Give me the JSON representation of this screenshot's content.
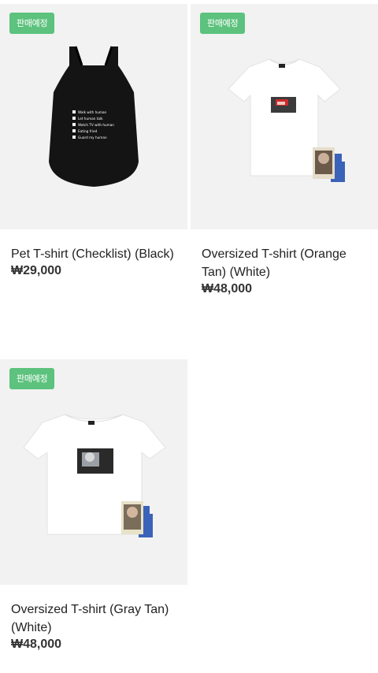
{
  "products": [
    {
      "badge": "판매예정",
      "title": "Pet T-shirt (Checklist) (Black)",
      "price": "₩29,000",
      "checklist": [
        "Walk with human",
        "Let human talk",
        "Watch TV with human",
        "Eating fried",
        "Guard my human"
      ]
    },
    {
      "badge": "판매예정",
      "title": "Oversized T-shirt (Orange Tan) (White)",
      "price": "₩48,000"
    },
    {
      "badge": "판매예정",
      "title": "Oversized T-shirt (Gray Tan) (White)",
      "price": "₩48,000"
    }
  ],
  "colors": {
    "badge_bg": "#5cc27d",
    "thumb_bg": "#f2f2f2",
    "accent_blue": "#3a62b8"
  }
}
